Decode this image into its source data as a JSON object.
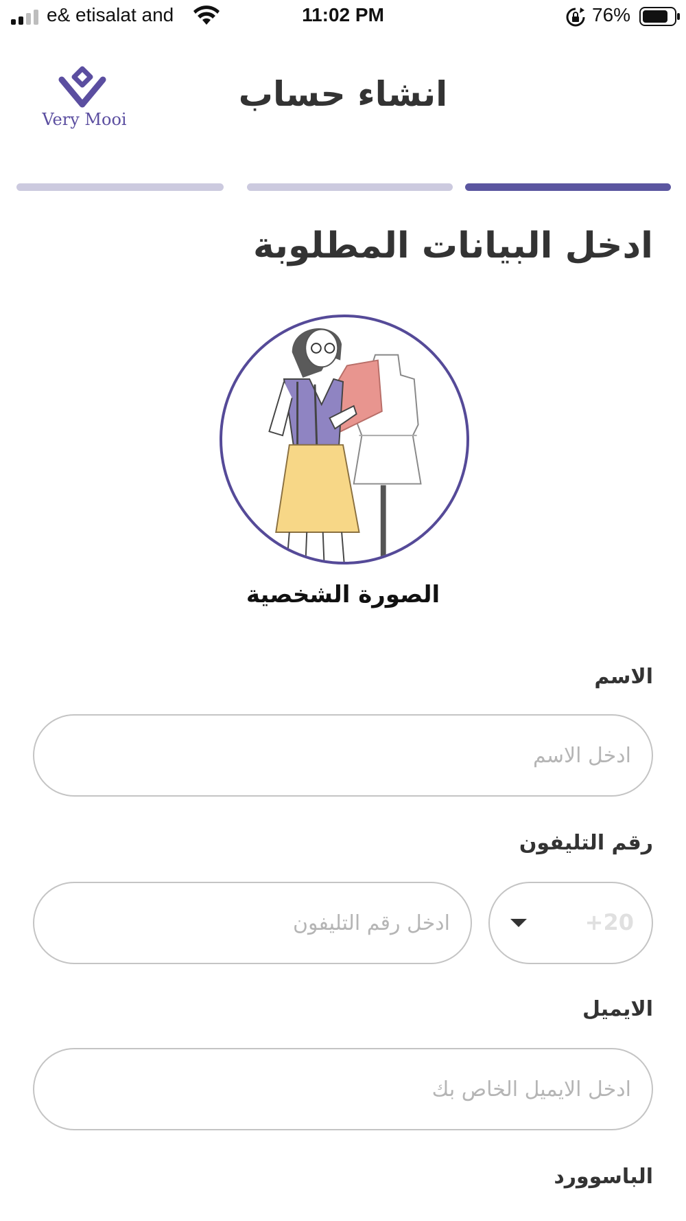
{
  "status_bar": {
    "carrier": "e& etisalat and",
    "time": "11:02 PM",
    "battery_percent": "76%"
  },
  "header": {
    "logo_text": "Very Mooi",
    "title": "انشاء حساب"
  },
  "progress": {
    "total_steps": 3,
    "current_step": 1
  },
  "section_heading": "ادخل البيانات المطلوبة",
  "avatar": {
    "label": "الصورة الشخصية"
  },
  "form": {
    "name": {
      "label": "الاسم",
      "placeholder": "ادخل الاسم"
    },
    "phone": {
      "label": "رقم التليفون",
      "placeholder": "ادخل رقم التليفون",
      "country_code": "+20"
    },
    "email": {
      "label": "الايميل",
      "placeholder": "ادخل الايميل الخاص بك"
    },
    "password": {
      "label": "الباسوورد"
    }
  },
  "colors": {
    "accent": "#5b56a0",
    "inactive_step": "#cccadf",
    "border": "#c4c4c4"
  },
  "icons": [
    "signal-icon",
    "wifi-icon",
    "rotation-lock-icon",
    "battery-icon",
    "dropdown-caret-icon"
  ]
}
